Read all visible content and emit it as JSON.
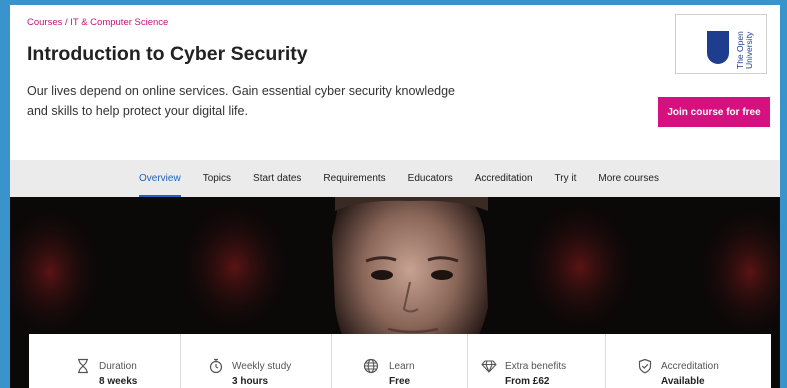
{
  "breadcrumb": {
    "root": "Courses",
    "separator": "/",
    "category": "IT & Computer Science"
  },
  "course": {
    "title": "Introduction to Cyber Security",
    "description": "Our lives depend on online services. Gain essential cyber security knowledge and skills to help protect your digital life."
  },
  "provider": {
    "logo_text_line1": "The Open",
    "logo_text_line2": "University",
    "logo_color": "#1f3d8f"
  },
  "join_button": {
    "label": "Join course for free",
    "color": "#d4117f"
  },
  "tabs": [
    {
      "label": "Overview",
      "active": true
    },
    {
      "label": "Topics"
    },
    {
      "label": "Start dates"
    },
    {
      "label": "Requirements"
    },
    {
      "label": "Educators"
    },
    {
      "label": "Accreditation"
    },
    {
      "label": "Try it"
    },
    {
      "label": "More courses"
    }
  ],
  "accent_color": "#1a64c8",
  "stats": [
    {
      "icon": "hourglass-icon",
      "label": "Duration",
      "value": "8 weeks"
    },
    {
      "icon": "stopwatch-icon",
      "label": "Weekly study",
      "value": "3 hours"
    },
    {
      "icon": "globe-icon",
      "label": "Learn",
      "value": "Free"
    },
    {
      "icon": "diamond-icon",
      "label": "Extra benefits",
      "value": "From £62"
    },
    {
      "icon": "shield-check-icon",
      "label": "Accreditation",
      "value": "Available"
    }
  ]
}
